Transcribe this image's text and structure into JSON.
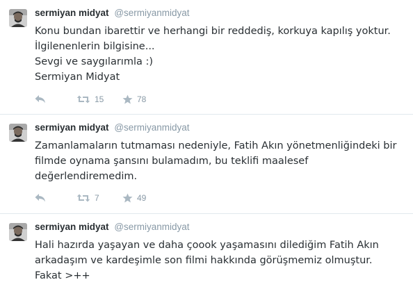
{
  "tweets": [
    {
      "display_name": "sermiyan midyat",
      "username": "@sermiyanmidyat",
      "lines": [
        "Konu bundan ibarettir ve herhangi bir reddediş, korkuya kapılış yoktur.",
        "İlgilenenlerin bilgisine...",
        "Sevgi ve saygılarımla :)",
        "Sermiyan Midyat"
      ],
      "retweets": "15",
      "favorites": "78"
    },
    {
      "display_name": "sermiyan midyat",
      "username": "@sermiyanmidyat",
      "lines": [
        "Zamanlamaların tutmaması nedeniyle, Fatih Akın yönetmenliğindeki bir",
        "filmde oynama şansını bulamadım, bu teklifi maalesef",
        "değerlendiremedim."
      ],
      "retweets": "7",
      "favorites": "49"
    },
    {
      "display_name": "sermiyan midyat",
      "username": "@sermiyanmidyat",
      "lines": [
        "Hali hazırda yaşayan ve daha çoook yaşamasını dilediğim Fatih Akın",
        "arkadaşım ve kardeşimle son filmi hakkında görüşmemiz olmuştur.",
        "Fakat >++"
      ]
    }
  ],
  "icons": {
    "avatar": "avatar",
    "reply": "reply-icon",
    "retweet": "retweet-icon",
    "favorite": "star-icon"
  },
  "colors": {
    "text": "#292f33",
    "muted": "#8899a6",
    "icon": "#aab8c2",
    "divider": "#e1e8ed"
  }
}
